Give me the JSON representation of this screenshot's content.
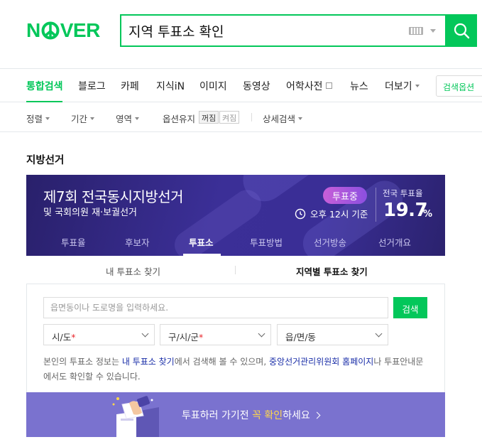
{
  "logo": {
    "text_left": "N",
    "text_right": "VER"
  },
  "search": {
    "query": "지역 투표소 확인"
  },
  "tabs": [
    {
      "label": "통합검색",
      "active": true
    },
    {
      "label": "블로그"
    },
    {
      "label": "카페"
    },
    {
      "label": "지식iN"
    },
    {
      "label": "이미지"
    },
    {
      "label": "동영상"
    },
    {
      "label": "어학사전"
    },
    {
      "label": "뉴스"
    },
    {
      "label": "더보기"
    }
  ],
  "search_options_label": "검색옵션",
  "filters": {
    "sort": "정렬",
    "period": "기간",
    "area": "영역",
    "keep_option": "옵션유지",
    "off": "꺼짐",
    "on": "켜짐",
    "detail": "상세검색"
  },
  "section": {
    "title": "지방선거"
  },
  "banner": {
    "title": "제7회 전국동시지방선거",
    "subtitle": "및 국회의원 재·보궐선거",
    "badge": "투표중",
    "time": "오후 12시 기준",
    "rate_label": "전국 투표율",
    "rate_value": "19.7",
    "rate_unit": "%"
  },
  "card_tabs": [
    {
      "label": "투표율"
    },
    {
      "label": "후보자"
    },
    {
      "label": "투표소",
      "active": true
    },
    {
      "label": "투표방법"
    },
    {
      "label": "선거방송"
    },
    {
      "label": "선거개요"
    }
  ],
  "sub_tabs": {
    "mine": "내 투표소 찾기",
    "regional": "지역별 투표소 찾기"
  },
  "address": {
    "placeholder": "읍면동이나 도로명을 입력하세요.",
    "button": "검색"
  },
  "selects": {
    "sido": "시/도",
    "gugun": "구/시/군",
    "dong": "읍/면/동",
    "required_mark": "*"
  },
  "notice": {
    "p1": "본인의 투표소 정보는 ",
    "link1": "내 투표소 찾기",
    "p2": "에서 검색해 볼 수 있으며, ",
    "link2": "중앙선거관리위원회 홈페이지",
    "p3": "나 투표안내문에서도 확인할 수 있습니다."
  },
  "cta": {
    "before": "투표하러 가기전 ",
    "highlight": "꼭 확인",
    "after": "하세요"
  },
  "colors": {
    "brand": "#03c75a",
    "banner": "#3b2f97",
    "cta": "#7a72cf",
    "highlight": "#ffd84a",
    "required": "#e8262b"
  }
}
